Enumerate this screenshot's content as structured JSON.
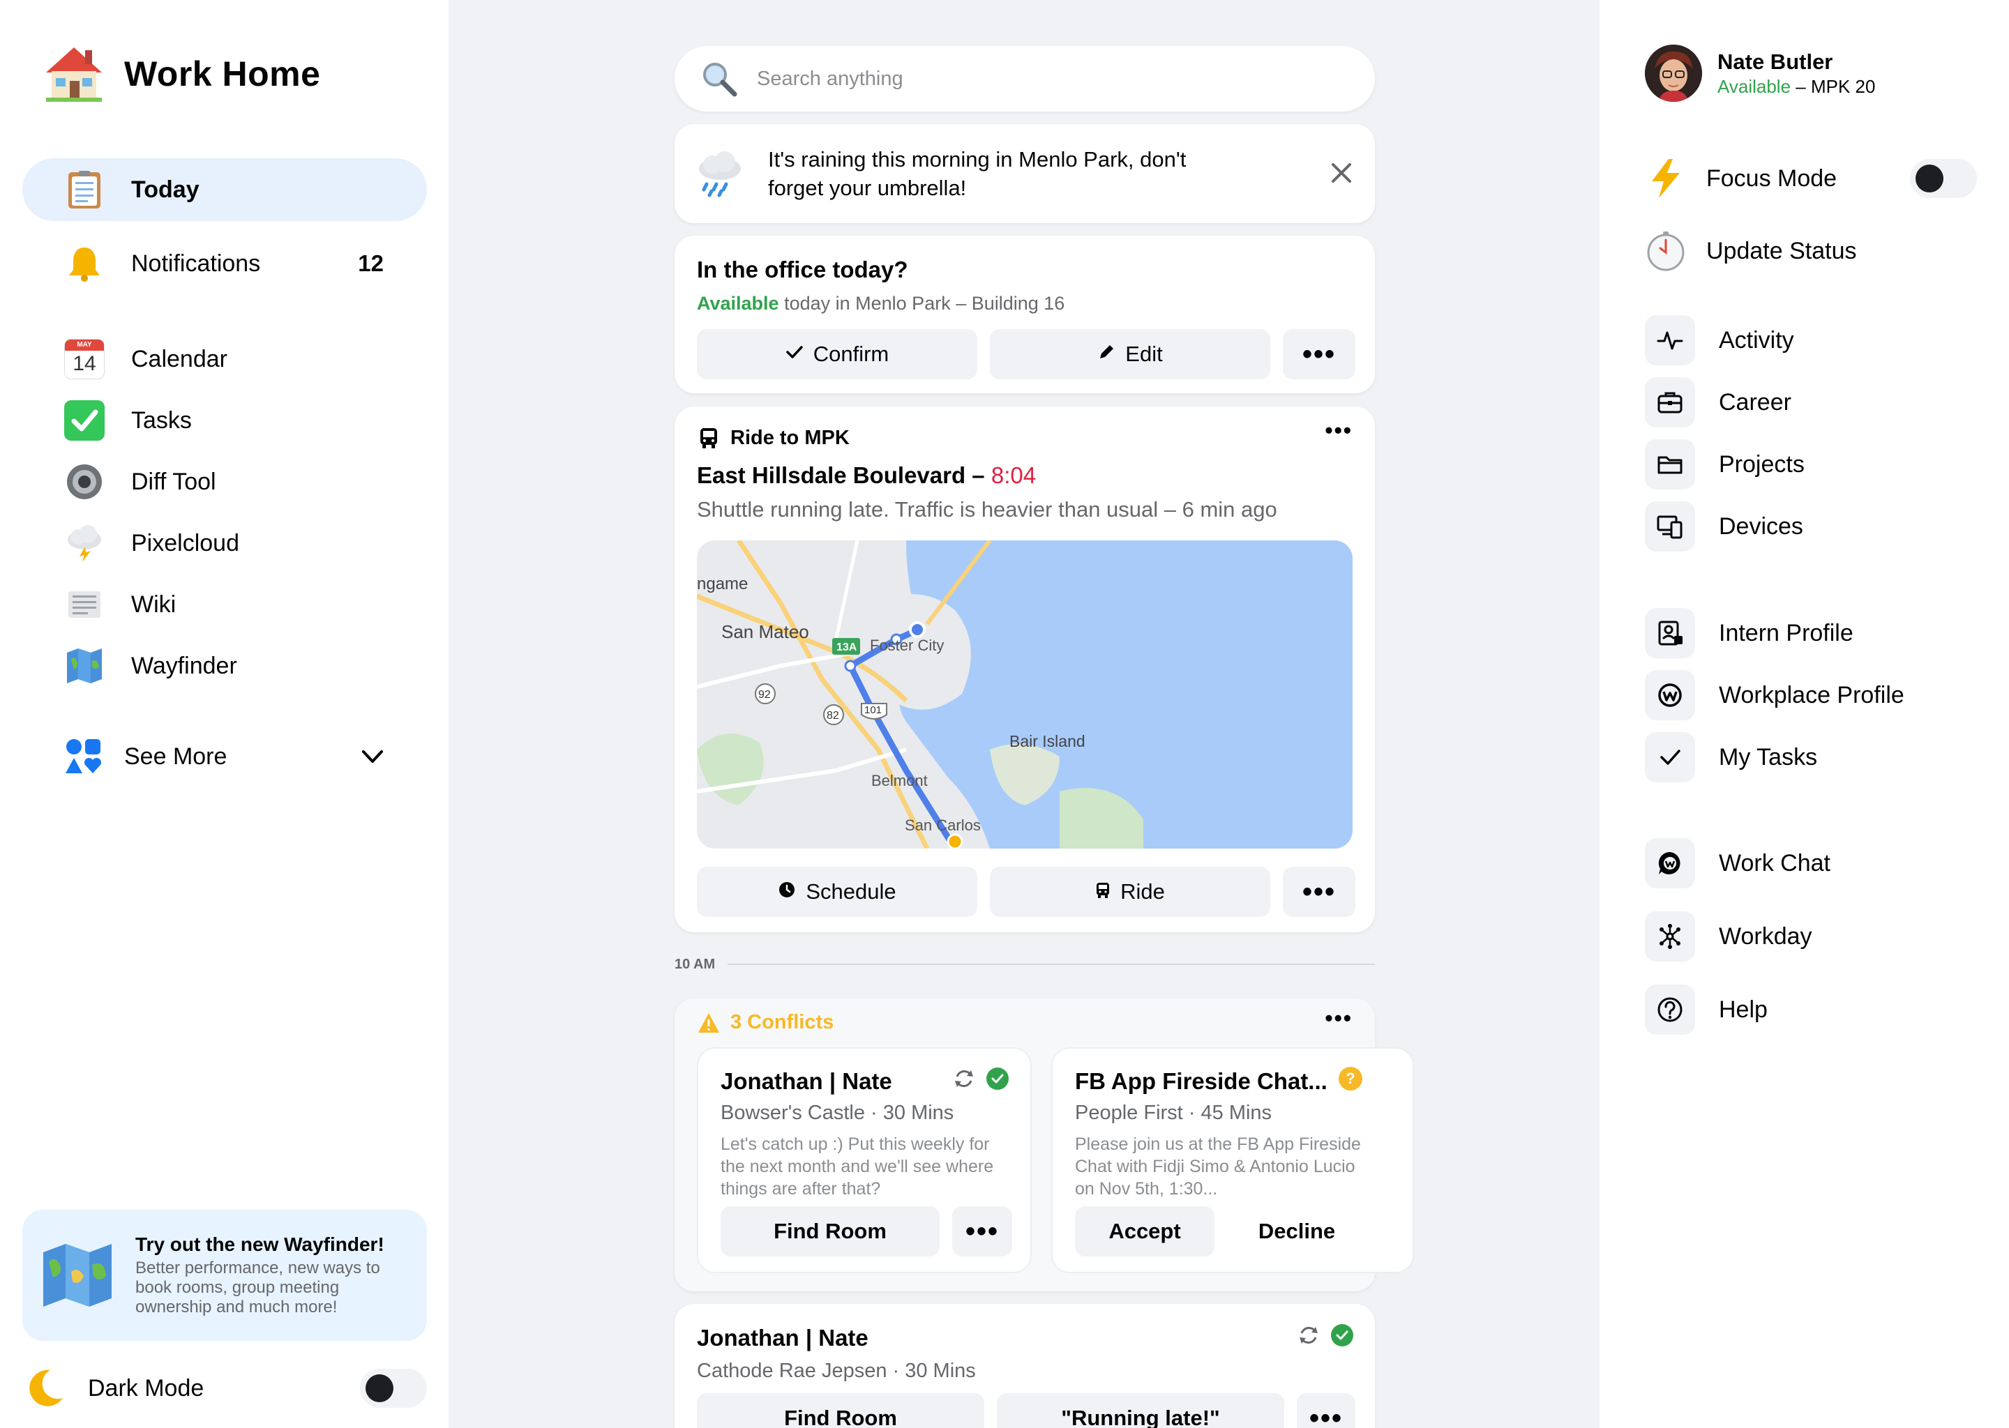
{
  "app": {
    "title": "Work Home"
  },
  "sidebar": {
    "items": [
      {
        "label": "Today",
        "icon": "clipboard-icon"
      },
      {
        "label": "Notifications",
        "icon": "bell-icon",
        "count": "12"
      },
      {
        "label": "Calendar",
        "icon": "calendar-icon",
        "icon_text": "14",
        "icon_month": "MAY"
      },
      {
        "label": "Tasks",
        "icon": "checkbox-icon"
      },
      {
        "label": "Diff Tool",
        "icon": "gear-icon"
      },
      {
        "label": "Pixelcloud",
        "icon": "cloud-icon"
      },
      {
        "label": "Wiki",
        "icon": "document-icon"
      },
      {
        "label": "Wayfinder",
        "icon": "map-icon"
      }
    ],
    "see_more": "See More",
    "promo": {
      "title": "Try out the new Wayfinder!",
      "body": "Better performance, new ways to book rooms, group meeting ownership and much more!"
    },
    "dark_mode": {
      "label": "Dark Mode",
      "enabled": false
    }
  },
  "search": {
    "placeholder": "Search anything"
  },
  "weather": {
    "message": "It's raining this morning in Menlo Park, don't forget your umbrella!"
  },
  "office": {
    "title": "In the office today?",
    "status": "Available",
    "detail": "today in Menlo Park – Building 16",
    "confirm": "Confirm",
    "edit": "Edit",
    "more": "•••"
  },
  "ride": {
    "header": "Ride to MPK",
    "street": "East Hillsdale Boulevard –",
    "time": "8:04",
    "note": "Shuttle running late. Traffic is heavier than usual – 6 min ago",
    "map_labels": {
      "burlingame": "ngame",
      "san_mateo": "San Mateo",
      "foster_city": "Foster City",
      "bair_island": "Bair Island",
      "belmont": "Belmont",
      "san_carlos": "San Carlos",
      "hwy_13a": "13A",
      "hwy_92": "92",
      "hwy_82": "82",
      "hwy_101": "101"
    },
    "schedule": "Schedule",
    "ride_btn": "Ride",
    "more": "•••"
  },
  "timeline": {
    "label": "10 AM"
  },
  "conflicts": {
    "header": "3 Conflicts",
    "more": "•••",
    "events": [
      {
        "title": "Jonathan | Nate",
        "meta": "Bowser's Castle · 30 Mins",
        "desc": "Let's catch up :) Put this weekly for the next month and we'll see where things are after that?",
        "primary": "Find Room",
        "more": "•••"
      },
      {
        "title": "FB App Fireside Chat...",
        "meta": "People First · 45 Mins",
        "desc": "Please join us at the FB App Fireside Chat with Fidji Simo & Antonio Lucio on Nov 5th, 1:30...",
        "accept": "Accept",
        "decline": "Decline",
        "status_mark": "?"
      }
    ]
  },
  "event2": {
    "title": "Jonathan | Nate",
    "meta": "Cathode Rae Jepsen · 30 Mins",
    "find_room": "Find Room",
    "running_late": "\"Running late!\"",
    "more": "•••"
  },
  "profile": {
    "name": "Nate Butler",
    "status": "Available",
    "location": " – MPK 20"
  },
  "quick": {
    "focus_mode": {
      "label": "Focus Mode",
      "enabled": false
    },
    "update_status": "Update Status"
  },
  "links": {
    "group1": [
      "Activity",
      "Career",
      "Projects",
      "Devices"
    ],
    "group2": [
      "Intern Profile",
      "Workplace Profile",
      "My Tasks"
    ],
    "group3": [
      "Work Chat",
      "Workday",
      "Help"
    ]
  },
  "colors": {
    "accent": "#1877f2",
    "available": "#31a24c",
    "late": "#e41e3f",
    "warning": "#f7b928",
    "active_bg": "#e7f0fd"
  }
}
